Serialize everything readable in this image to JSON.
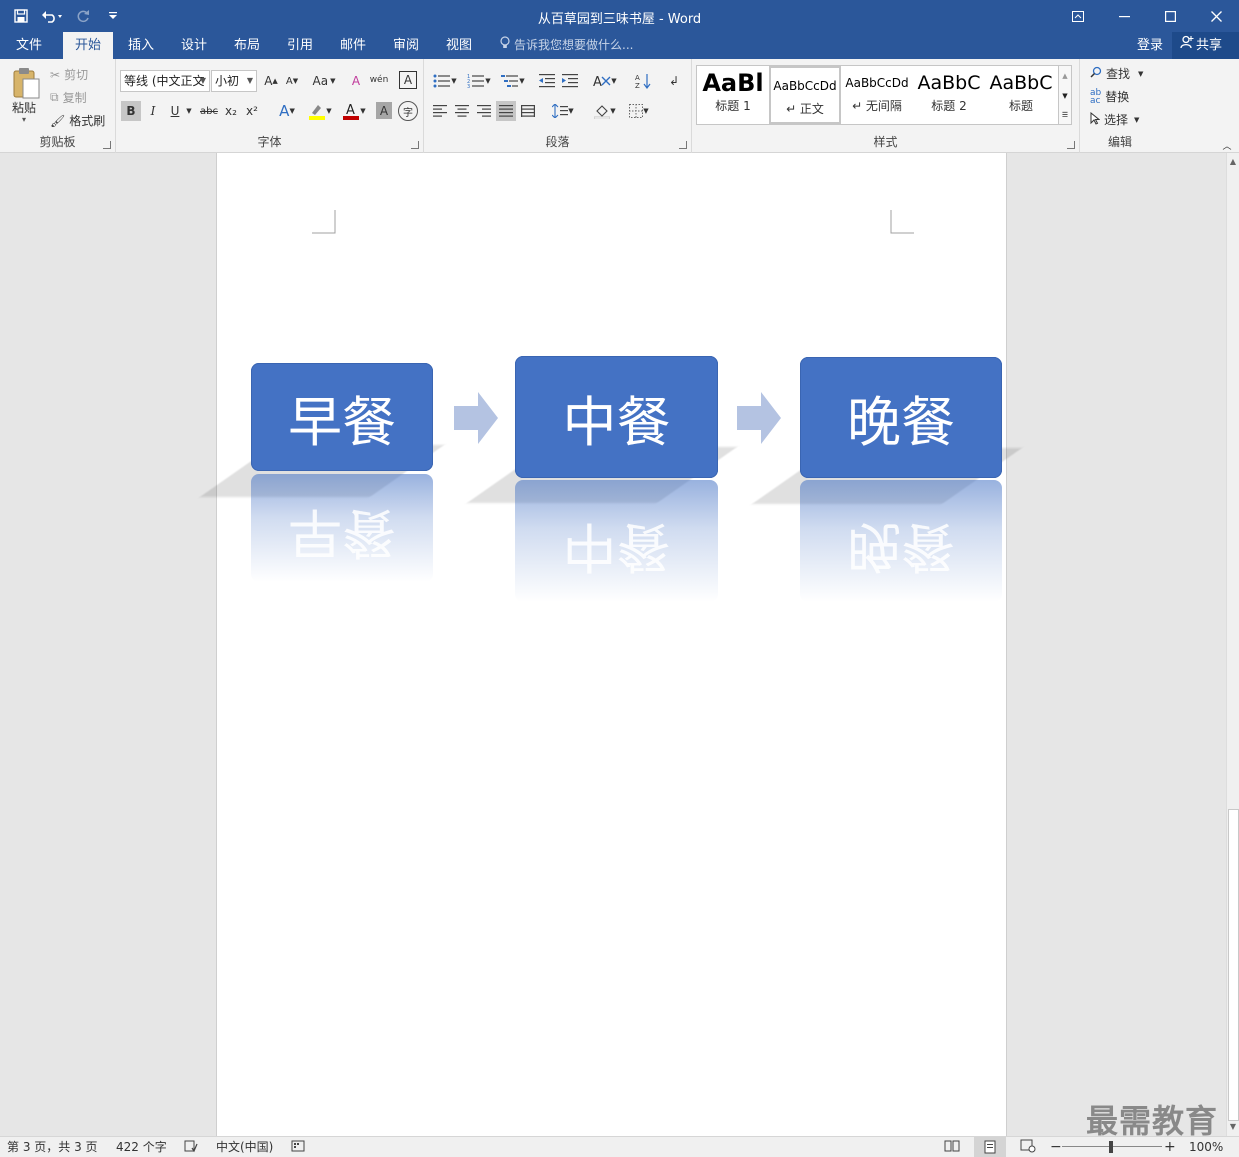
{
  "app": {
    "title": "从百草园到三味书屋 - Word",
    "login": "登录",
    "share": "共享"
  },
  "qat": {
    "save_icon": "save-icon",
    "undo_icon": "undo-icon",
    "redo_icon": "redo-icon",
    "customize_icon": "customize-qat-icon"
  },
  "tabs": [
    "文件",
    "开始",
    "插入",
    "设计",
    "布局",
    "引用",
    "邮件",
    "审阅",
    "视图"
  ],
  "active_tab": "开始",
  "tellme_placeholder": "告诉我您想要做什么...",
  "ribbon": {
    "clipboard": {
      "label": "剪贴板",
      "paste": "粘贴",
      "cut": "剪切",
      "copy": "复制",
      "format_painter": "格式刷"
    },
    "font": {
      "label": "字体",
      "font_name": "等线 (中文正文",
      "font_size": "小初",
      "change_case": "Aa",
      "bold": "B",
      "italic": "I",
      "underline": "U",
      "strikethrough": "abc",
      "subscript": "x₂",
      "superscript": "x²",
      "grow": "A",
      "shrink": "A",
      "char_border": "A",
      "char_shading": "A",
      "phonetic": "wén",
      "enclose": "字"
    },
    "paragraph": {
      "label": "段落"
    },
    "styles": {
      "label": "样式",
      "items": [
        {
          "sample": "AaBl",
          "name": "标题 1"
        },
        {
          "sample": "AaBbCcDd",
          "name": "↵ 正文"
        },
        {
          "sample": "AaBbCcDd",
          "name": "↵ 无间隔"
        },
        {
          "sample": "AaBbC",
          "name": "标题 2"
        },
        {
          "sample": "AaBbC",
          "name": "标题"
        }
      ]
    },
    "editing": {
      "label": "编辑",
      "find": "查找",
      "replace": "替换",
      "select": "选择"
    }
  },
  "document": {
    "smartart": [
      {
        "text": "早餐"
      },
      {
        "text": "中餐"
      },
      {
        "text": "晚餐"
      }
    ],
    "accent_color": "#4472c4",
    "arrow_color": "#b4c3e2"
  },
  "status": {
    "page": "第 3 页，共 3 页",
    "words": "422 个字",
    "language": "中文(中国)",
    "zoom": "100%"
  },
  "watermark": "最需教育"
}
